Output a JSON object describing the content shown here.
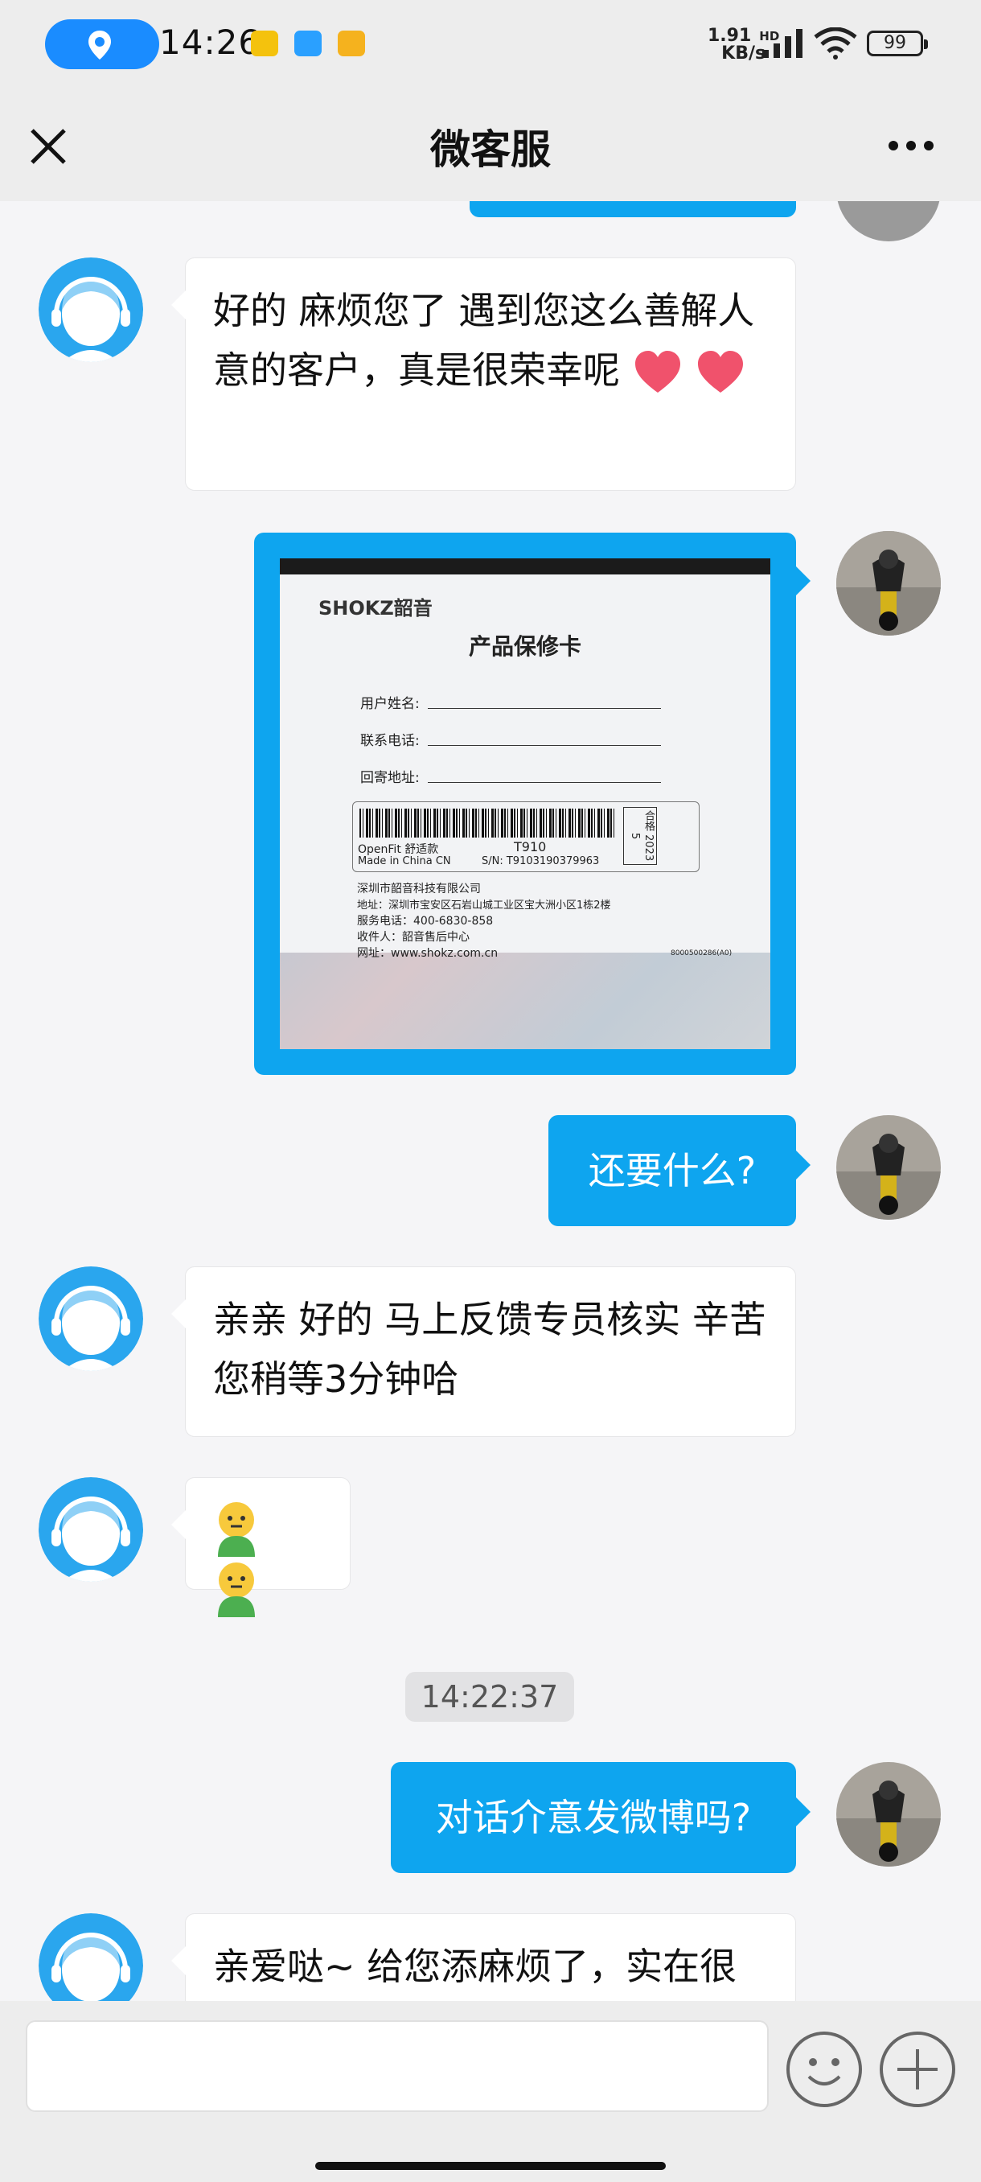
{
  "status_bar": {
    "time": "14:26",
    "net_speed_value": "1.91",
    "net_speed_unit": "KB/s",
    "net_type": "HD",
    "battery": "99"
  },
  "header": {
    "title": "微客服"
  },
  "messages": {
    "m1": {
      "text": "好的 麻烦您了 遇到您这么善解人意的客户，真是很荣幸呢"
    },
    "m3": {
      "text": "还要什么?"
    },
    "m4": {
      "text": "亲亲 好的 马上反馈专员核实 辛苦您稍等3分钟哈"
    },
    "timestamp": "14:22:37",
    "m6": {
      "text": "对话介意发微博吗?"
    },
    "m7": {
      "text": "亲爱哒~ 给您添麻烦了，实在很"
    }
  },
  "warranty_card": {
    "brand": "SHOKZ韶音",
    "title": "产品保修卡",
    "field_name": "用户姓名:",
    "field_phone": "联系电话:",
    "field_address": "回寄地址:",
    "product": "OpenFit 舒适款",
    "model": "T910",
    "origin": "Made in China   CN",
    "serial": "S/N: T9103190379963",
    "stamp": "合格 2023 5",
    "company": "深圳市韶音科技有限公司",
    "address": "地址：深圳市宝安区石岩山城工业区宝大洲小区1栋2楼",
    "service_phone": "服务电话：400-6830-858",
    "receiver": "收件人：韶音售后中心",
    "website": "网址：www.shokz.com.cn",
    "code": "8000500286(A0)"
  },
  "input": {
    "value": "",
    "placeholder": ""
  },
  "colors": {
    "accent": "#0ea5ef",
    "header_bg": "#ededed",
    "chat_bg": "#f5f5f7"
  }
}
